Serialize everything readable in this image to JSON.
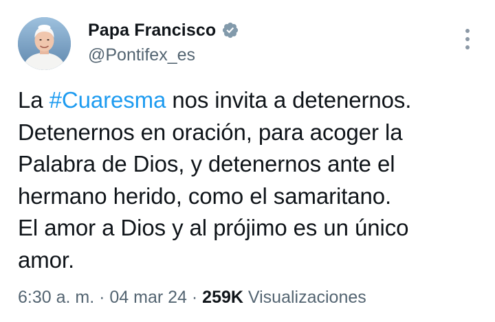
{
  "author": {
    "display_name": "Papa Francisco",
    "handle": "@Pontifex_es",
    "verified_color": "#829aab"
  },
  "tweet": {
    "line1_prefix": "La ",
    "hashtag": "#Cuaresma",
    "line1_suffix": " nos invita a detenernos.",
    "line2": "Detenernos en oración, para acoger la",
    "line3": "Palabra de Dios, y detenernos ante el",
    "line4": "hermano herido, como el samaritano.",
    "line5": "El amor a Dios y al prójimo es un único",
    "line6": "amor."
  },
  "meta": {
    "time": "6:30 a. m.",
    "separator": " · ",
    "date": "04 mar 24",
    "views_count": "259K",
    "views_label": "Visualizaciones"
  },
  "colors": {
    "link": "#1d9bf0",
    "text": "#0f1419",
    "muted": "#536471"
  },
  "icons": {
    "verified": "verified-badge-icon",
    "more": "more-options-icon"
  }
}
